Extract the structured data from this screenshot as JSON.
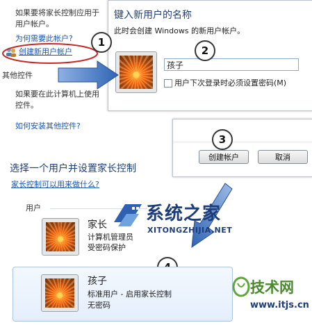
{
  "left_panel": {
    "line1": "如果要将家长控制应用于",
    "line2": "用户帐户。",
    "why_link": "为何需要此帐户?",
    "create_link": "创建新用户帐户",
    "section_title": "其他控件",
    "desc1": "如果要在此计算机上使用",
    "desc2": "控件。",
    "install_link": "如何安装其他控件?"
  },
  "dialog": {
    "title": "键入新用户的名称",
    "description": "此时会创建 Windows 的新用户帐户。",
    "name_value": "孩子",
    "checkbox_label": "用户下次登录时必须设置密码(M)"
  },
  "buttons": {
    "create": "创建帐户",
    "cancel": "取消"
  },
  "badges": [
    "1",
    "2",
    "3",
    "4"
  ],
  "main": {
    "heading": "选择一个用户并设置家长控制",
    "what_link": "家长控制可以用来做什么?",
    "users_label": "用户"
  },
  "users": [
    {
      "name": "家长",
      "line1": "计算机管理员",
      "line2": "受密码保护"
    },
    {
      "name": "孩子",
      "line1": "标准用户 - 启用家长控制",
      "line2": "无密码"
    }
  ],
  "watermark": {
    "brand": "系统之家",
    "brand_sub": "XITONGZHIJIA.NET",
    "site_name": "技术网",
    "site_url": "www.itjs.cn"
  },
  "colors": {
    "link": "#1a56b0",
    "title": "#1f3f7a",
    "arrow": "#2f64b5",
    "highlight": "#c62828"
  }
}
